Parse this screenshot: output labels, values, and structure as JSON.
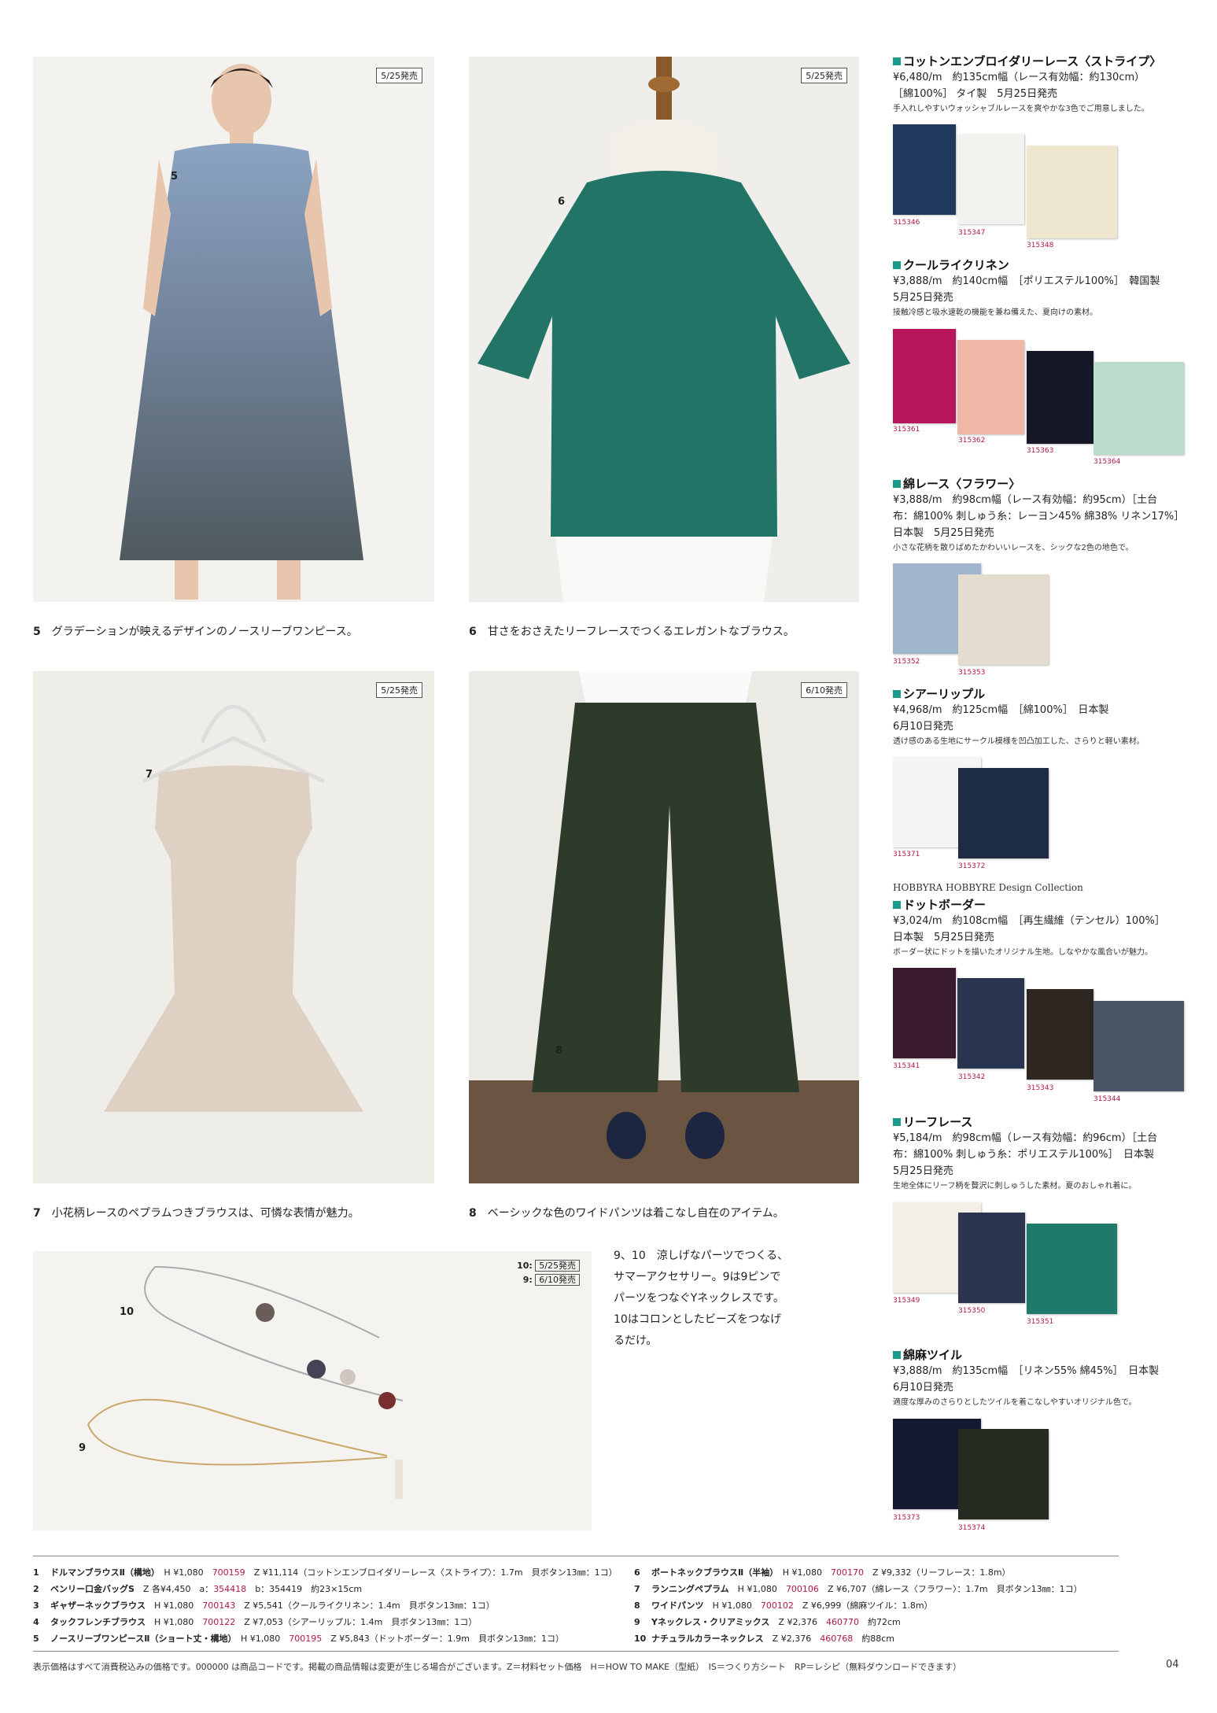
{
  "photos": [
    {
      "num": "5",
      "badge": "5/25発売",
      "caption_num": "5",
      "caption": "グラデーションが映えるデザインのノースリーブワンピース。"
    },
    {
      "num": "6",
      "badge": "5/25発売",
      "caption_num": "6",
      "caption": "甘さをおさえたリーフレースでつくるエレガントなブラウス。"
    },
    {
      "num": "7",
      "badge": "5/25発売",
      "caption_num": "7",
      "caption": "小花柄レースのペプラムつきブラウスは、可憐な表情が魅力。"
    },
    {
      "num": "8",
      "badge": "6/10発売",
      "caption_num": "8",
      "caption": "ベーシックな色のワイドパンツは着こなし自在のアイテム。"
    }
  ],
  "accessory": {
    "num10": "10",
    "num9": "9",
    "badge10_label": "10:",
    "badge10": "5/25発売",
    "badge9_label": "9:",
    "badge9": "6/10発売",
    "text_line1": "9、10　涼しげなパーツでつくる、",
    "text_line2": "サマーアクセサリー。9は9ピンで",
    "text_line3": "パーツをつなぐYネックレスです。",
    "text_line4": "10はコロンとしたビーズをつなげ",
    "text_line5": "るだけ。"
  },
  "fabrics": [
    {
      "title": "コットンエンブロイダリーレース〈ストライプ〉",
      "info1": "¥6,480/m　約135cm幅（レース有効幅：約130cm）",
      "info2": "［綿100%］ タイ製　5月25日発売",
      "info3": "",
      "note": "手入れしやすいウォッシャブルレースを爽やかな3色でご用意しました。",
      "codes": [
        "315346",
        "315347",
        "315348"
      ],
      "colors": [
        "#1f3a5c",
        "#f2f2ee",
        "#efe6cf"
      ]
    },
    {
      "title": "クールライクリネン",
      "info1": "¥3,888/m　約140cm幅　［ポリエステル100%］　韓国製",
      "info2": "5月25日発売",
      "info3": "",
      "note": "接触冷感と吸水速乾の機能を兼ね備えた、夏向けの素材。",
      "codes": [
        "315361",
        "315362",
        "315363",
        "315364"
      ],
      "colors": [
        "#b8155a",
        "#efb7a6",
        "#151726",
        "#b9dccb"
      ]
    },
    {
      "title": "綿レース〈フラワー〉",
      "info1": "¥3,888/m　約98cm幅（レース有効幅：約95cm）［土台",
      "info2": "布：綿100% 刺しゅう糸：レーヨン45% 綿38% リネン17%］",
      "info3": "日本製　5月25日発売",
      "note": "小さな花柄を散りばめたかわいいレースを、シックな2色の地色で。",
      "codes": [
        "315352",
        "315353"
      ],
      "colors": [
        "#9fb6cc",
        "#e4ddcf"
      ]
    },
    {
      "title": "シアーリップル",
      "info1": "¥4,968/m　約125cm幅　［綿100%］　日本製",
      "info2": "6月10日発売",
      "info3": "",
      "note": "透け感のある生地にサークル模様を凹凸加工した、さらりと軽い素材。",
      "codes": [
        "315371",
        "315372"
      ],
      "colors": [
        "#f4f4f4",
        "#1e2b45"
      ]
    },
    {
      "title": "ドットボーダー",
      "brand": "HOBBYRA HOBBYRE  Design Collection",
      "info1": "¥3,024/m　約108cm幅　［再生繊維（テンセル）100%］",
      "info2": "日本製　5月25日発売",
      "info3": "",
      "note": "ボーダー状にドットを描いたオリジナル生地。しなやかな風合いが魅力。",
      "codes": [
        "315341",
        "315342",
        "315343",
        "315344"
      ],
      "colors": [
        "#3a1a30",
        "#2a3550",
        "#2e2620",
        "#4a5566"
      ]
    },
    {
      "title": "リーフレース",
      "info1": "¥5,184/m　約98cm幅（レース有効幅：約96cm）［土台",
      "info2": "布：綿100% 刺しゅう糸：ポリエステル100%］　日本製",
      "info3": "5月25日発売",
      "note": "生地全体にリーフ柄を贅沢に刺しゅうした素材。夏のおしゃれ着に。",
      "codes": [
        "315349",
        "315350",
        "315351"
      ],
      "colors": [
        "#f3efe6",
        "#2c3550",
        "#1f7a6c"
      ]
    },
    {
      "title": "綿麻ツイル",
      "info1": "¥3,888/m　約135cm幅　［リネン55% 綿45%］　日本製",
      "info2": "6月10日発売",
      "info3": "",
      "note": "適度な厚みのさらりとしたツイルを着こなしやすいオリジナル色で。",
      "codes": [
        "315373",
        "315374"
      ],
      "colors": [
        "#151a30",
        "#262b22"
      ]
    }
  ],
  "table_left": [
    {
      "n": "1",
      "text_a": "ドルマンブラウスⅡ（構地）",
      "text_b": "H ¥1,080",
      "code": "700159",
      "text_c": "Z ¥11,114（コットンエンブロイダリーレース〈ストライプ〉：1.7m　貝ボタン13㎜：1コ）"
    },
    {
      "n": "2",
      "text_a": "ベンリー口金バッグS",
      "text_b": "Z 各¥4,450　a：",
      "code": "354418",
      "text_c": "b：354419　約23×15cm"
    },
    {
      "n": "3",
      "text_a": "ギャザーネックブラウス",
      "text_b": "H ¥1,080",
      "code": "700143",
      "text_c": "Z ¥5,541（クールライクリネン：1.4m　貝ボタン13㎜：1コ）"
    },
    {
      "n": "4",
      "text_a": "タックフレンチブラウス",
      "text_b": "H ¥1,080",
      "code": "700122",
      "text_c": "Z ¥7,053（シアーリップル：1.4m　貝ボタン13㎜：1コ）"
    },
    {
      "n": "5",
      "text_a": "ノースリーブワンピースⅡ（ショート丈・構地）",
      "text_b": "H ¥1,080",
      "code": "700195",
      "text_c": "Z ¥5,843（ドットボーダー：1.9m　貝ボタン13㎜：1コ）"
    }
  ],
  "table_right": [
    {
      "n": "6",
      "text_a": "ボートネックブラウスⅡ（半袖）",
      "text_b": "H ¥1,080",
      "code": "700170",
      "text_c": "Z ¥9,332（リーフレース：1.8m）"
    },
    {
      "n": "7",
      "text_a": "ランニングペプラム",
      "text_b": "H ¥1,080",
      "code": "700106",
      "text_c": "Z ¥6,707（綿レース〈フラワー〉：1.7m　貝ボタン13㎜：1コ）"
    },
    {
      "n": "8",
      "text_a": "ワイドパンツ",
      "text_b": "H ¥1,080",
      "code": "700102",
      "text_c": "Z ¥6,999（綿麻ツイル：1.8m）"
    },
    {
      "n": "9",
      "text_a": "Yネックレス・クリアミックス",
      "text_b": "Z ¥2,376",
      "code": "460770",
      "text_c": "約72cm"
    },
    {
      "n": "10",
      "text_a": "ナチュラルカラーネックレス",
      "text_b": "Z ¥2,376",
      "code": "460768",
      "text_c": "約88cm"
    }
  ],
  "footer": {
    "note": "表示価格はすべて消費税込みの価格です。000000 は商品コードです。掲載の商品情報は変更が生じる場合がございます。Z＝材料セット価格　H＝HOW TO MAKE（型紙）　IS＝つくり方シート　RP＝レシピ（無料ダウンロードできます）",
    "page": "04"
  },
  "colors": {
    "accent": "#1a9a8a",
    "code": "#b0174a"
  }
}
